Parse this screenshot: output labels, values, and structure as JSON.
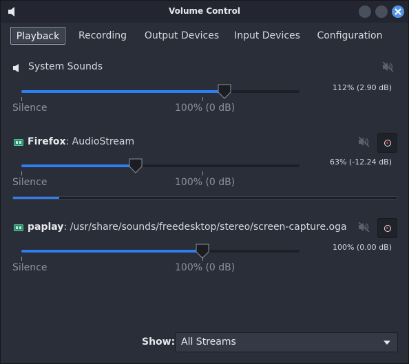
{
  "window": {
    "title": "Volume Control"
  },
  "tabs": [
    {
      "label": "Playback",
      "active": true
    },
    {
      "label": "Recording",
      "active": false
    },
    {
      "label": "Output Devices",
      "active": false
    },
    {
      "label": "Input Devices",
      "active": false
    },
    {
      "label": "Configuration",
      "active": false
    }
  ],
  "streams": [
    {
      "name": "System Sounds",
      "app": "",
      "icon": "speaker-icon",
      "volume_text": "112% (2.90 dB)",
      "volume_fraction": 0.73,
      "scale_labels": {
        "min": "Silence",
        "mid": "100% (0 dB)"
      },
      "has_lock": false
    },
    {
      "name": "Firefox",
      "app": ": AudioStream",
      "icon": "audio-card-icon",
      "volume_text": "63% (-12.24 dB)",
      "volume_fraction": 0.41,
      "scale_labels": {
        "min": "Silence",
        "mid": "100% (0 dB)"
      },
      "has_lock": true,
      "peak_fraction": 0.12
    },
    {
      "name": "paplay",
      "app": ": /usr/share/sounds/freedesktop/stereo/screen-capture.oga",
      "icon": "audio-card-icon",
      "volume_text": "100% (0.00 dB)",
      "volume_fraction": 0.65,
      "scale_labels": {
        "min": "Silence",
        "mid": "100% (0 dB)"
      },
      "has_lock": true
    }
  ],
  "bottom": {
    "show_label": "Show:",
    "show_value": "All Streams"
  },
  "colors": {
    "accent": "#2d7ef1",
    "close_button": "#5294e2",
    "lock_dot": "#e0304a"
  }
}
